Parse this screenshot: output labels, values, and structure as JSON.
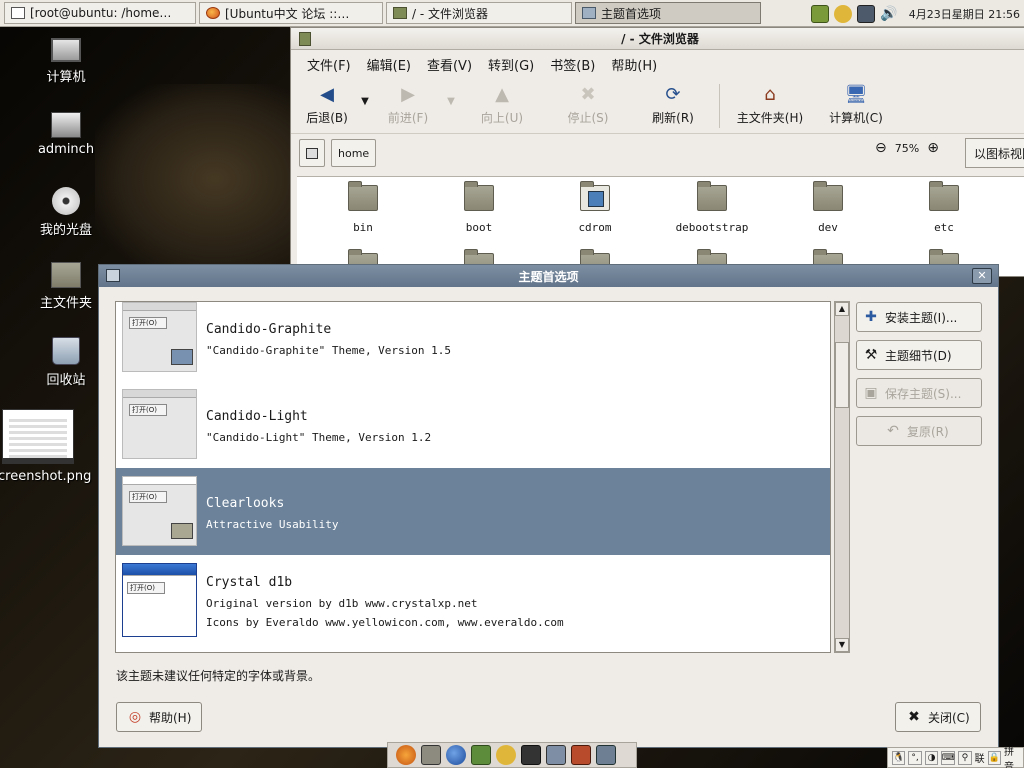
{
  "top_panel": {
    "tasks": [
      {
        "label": "[root@ubuntu: /home…",
        "icon": "terminal-icon"
      },
      {
        "label": "[Ubuntu中文 论坛 ::…",
        "icon": "firefox-icon"
      },
      {
        "label": "/ - 文件浏览器",
        "icon": "file-manager-icon"
      },
      {
        "label": "主题首选项",
        "icon": "theme-icon",
        "active": true
      }
    ],
    "clock": "4月23日星期日 21:56"
  },
  "desktop": {
    "icons": [
      {
        "label": "计算机",
        "icon": "computer-icon"
      },
      {
        "label": "adminch",
        "icon": "network-share-icon"
      },
      {
        "label": "我的光盘",
        "icon": "cdrom-icon"
      },
      {
        "label": "主文件夹",
        "icon": "home-folder-icon"
      },
      {
        "label": "回收站",
        "icon": "trash-icon"
      },
      {
        "label": "creenshot.png",
        "icon": "image-file-icon"
      }
    ]
  },
  "file_browser": {
    "title": "/ - 文件浏览器",
    "menu": [
      "文件(F)",
      "编辑(E)",
      "查看(V)",
      "转到(G)",
      "书签(B)",
      "帮助(H)"
    ],
    "toolbar": {
      "back": "后退(B)",
      "forward": "前进(F)",
      "up": "向上(U)",
      "stop": "停止(S)",
      "reload": "刷新(R)",
      "home": "主文件夹(H)",
      "computer": "计算机(C)"
    },
    "location": {
      "home_button": "home"
    },
    "zoom": "75%",
    "view_mode": "以图标视图",
    "files": [
      "bin",
      "boot",
      "cdrom",
      "debootstrap",
      "dev",
      "etc"
    ]
  },
  "theme_dialog": {
    "title": "主题首选项",
    "themes": [
      {
        "name": "Candido-Graphite",
        "desc": [
          "\"Candido-Graphite\" Theme, Version 1.5"
        ],
        "thumb_button": "打开(O)"
      },
      {
        "name": "Candido-Light",
        "desc": [
          "\"Candido-Light\" Theme, Version 1.2"
        ],
        "thumb_button": "打开(O)"
      },
      {
        "name": "Clearlooks",
        "desc": [
          "Attractive Usability"
        ],
        "thumb_button": "打开(O)",
        "selected": true
      },
      {
        "name": "Crystal d1b",
        "desc": [
          "Original version by d1b www.crystalxp.net",
          "Icons by Everaldo www.yellowicon.com, www.everaldo.com"
        ],
        "thumb_button": "打开(O)"
      }
    ],
    "buttons": {
      "install": "安装主题(I)...",
      "details": "主题细节(D)",
      "save": "保存主题(S)...",
      "revert": "复原(R)",
      "help": "帮助(H)",
      "close": "关闭(C)"
    },
    "hint": "该主题未建议任何特定的字体或背景。"
  },
  "bottom_panel": {
    "ime": [
      "联",
      "拼音"
    ]
  }
}
